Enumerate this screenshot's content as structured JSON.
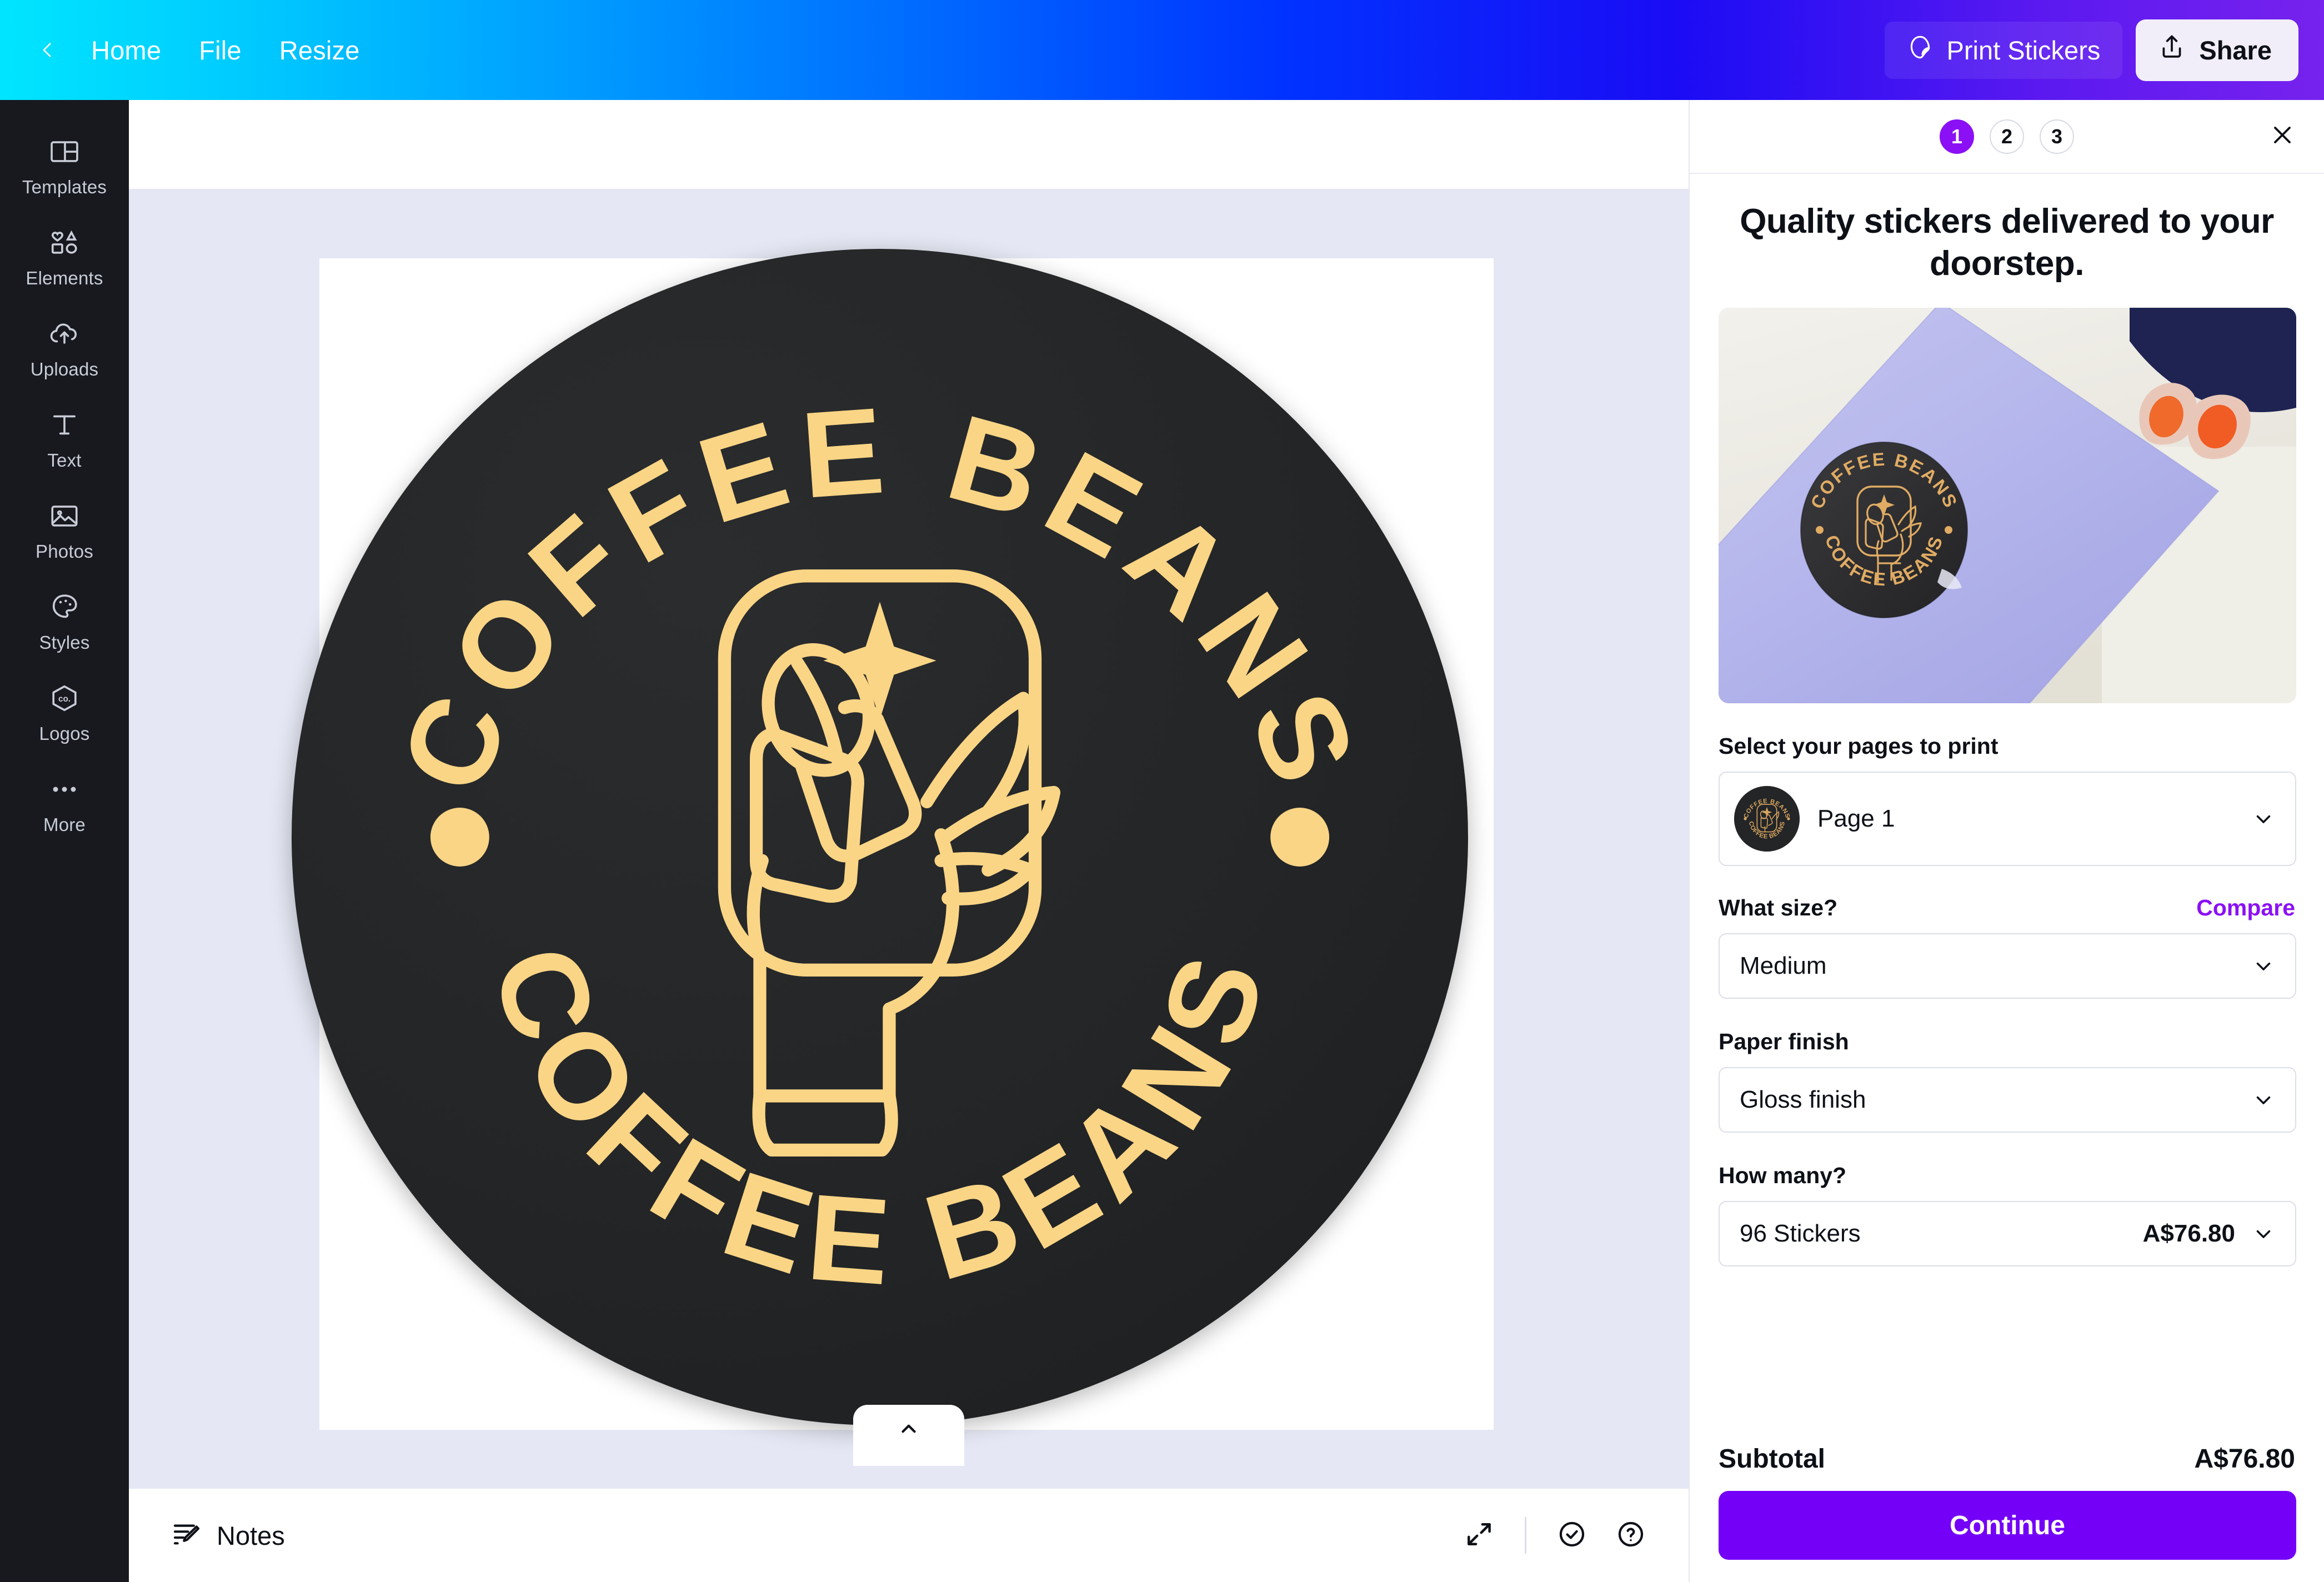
{
  "header": {
    "back_icon": "chevron-left-icon",
    "menu": [
      {
        "label": "Home"
      },
      {
        "label": "File"
      },
      {
        "label": "Resize"
      }
    ],
    "print_stickers_label": "Print Stickers",
    "print_stickers_icon": "sticker-peel-icon",
    "share_label": "Share",
    "share_icon": "share-upload-icon",
    "gradient_start": "#00e5ff",
    "gradient_mid": "#0033ff",
    "gradient_end": "#7722ee"
  },
  "sidebar": {
    "items": [
      {
        "label": "Templates",
        "icon": "templates-layout-icon"
      },
      {
        "label": "Elements",
        "icon": "elements-shapes-icon"
      },
      {
        "label": "Uploads",
        "icon": "cloud-upload-icon"
      },
      {
        "label": "Text",
        "icon": "text-t-icon"
      },
      {
        "label": "Photos",
        "icon": "photo-image-icon"
      },
      {
        "label": "Styles",
        "icon": "palette-icon"
      },
      {
        "label": "Logos",
        "icon": "hexagon-co-icon"
      },
      {
        "label": "More",
        "icon": "more-dots-icon"
      }
    ],
    "background": "#17191f"
  },
  "canvas": {
    "background": "#e5e8f4",
    "artboard_background": "#ffffff",
    "collapse_icon": "chevron-up-icon",
    "sticker": {
      "background": "#232527",
      "ink": "#fad585",
      "top_text": "COFFEE BEANS",
      "bottom_text": "COFFEE BEANS",
      "emblem": "hand-holding-coffee-bean-with-sparkle"
    }
  },
  "bottom_bar": {
    "notes_label": "Notes",
    "notes_icon": "notes-pencil-icon",
    "fullscreen_icon": "expand-arrows-icon",
    "check_icon": "check-circle-icon",
    "help_icon": "help-question-circle-icon"
  },
  "panel": {
    "steps": [
      {
        "label": "1",
        "active": true
      },
      {
        "label": "2",
        "active": false
      },
      {
        "label": "3",
        "active": false
      }
    ],
    "close_icon": "close-x-icon",
    "active_step_color": "#8b10f5",
    "title": "Quality stickers delivered to your doorstep.",
    "hero_image": "lavender-laptop-with-coffee-beans-sticker-and-hand",
    "pages_label": "Select your pages to print",
    "page_value": "Page 1",
    "page_thumbnail": "coffee-beans-sticker-thumbnail",
    "size_label": "What size?",
    "compare_label": "Compare",
    "size_value": "Medium",
    "finish_label": "Paper finish",
    "finish_value": "Gloss finish",
    "quantity_label": "How many?",
    "quantity_value": "96 Stickers",
    "quantity_price": "A$76.80",
    "subtotal_label": "Subtotal",
    "subtotal_value": "A$76.80",
    "continue_label": "Continue",
    "continue_color": "#7400f8",
    "compare_color": "#8b10f5",
    "caret_icon": "chevron-down-icon"
  }
}
